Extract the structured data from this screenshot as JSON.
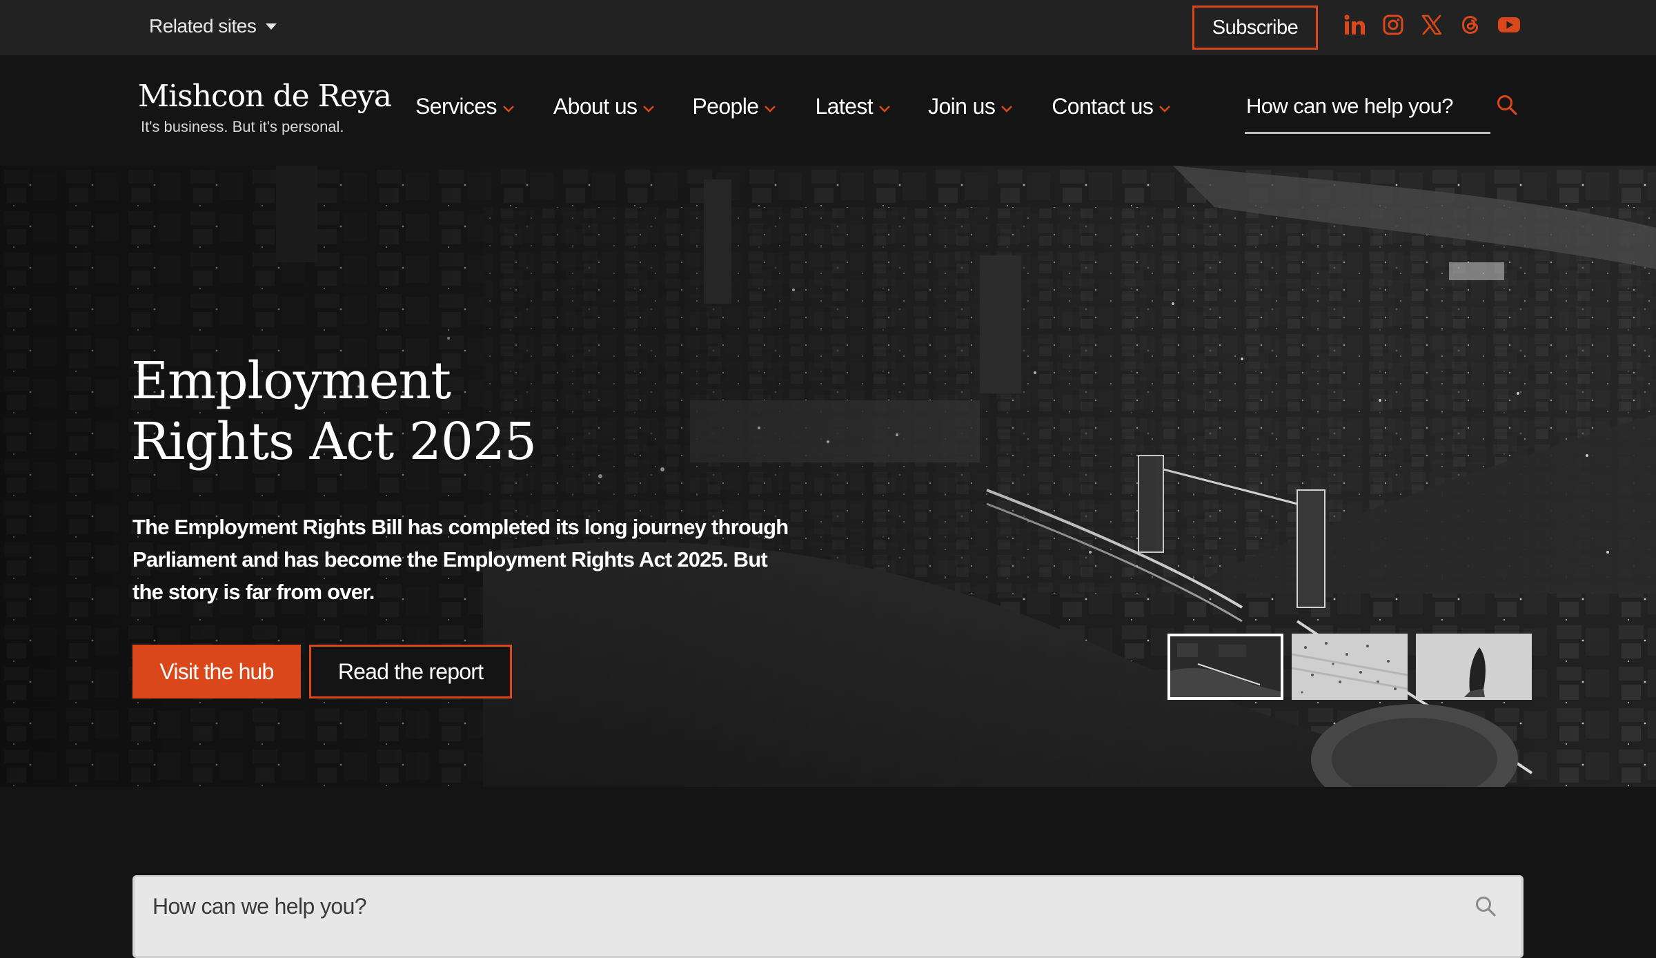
{
  "topbar": {
    "related_label": "Related sites",
    "subscribe_label": "Subscribe",
    "social_icons": [
      "linkedin-icon",
      "instagram-icon",
      "x-icon",
      "threads-icon",
      "youtube-icon"
    ]
  },
  "logo": {
    "name": "Mishcon de Reya",
    "tagline": "It's business. But it's personal."
  },
  "nav": {
    "items": [
      {
        "label": "Services"
      },
      {
        "label": "About us"
      },
      {
        "label": "People"
      },
      {
        "label": "Latest"
      },
      {
        "label": "Join us"
      },
      {
        "label": "Contact us"
      }
    ],
    "search_placeholder": "How can we help you?"
  },
  "hero": {
    "title_line1": "Employment",
    "title_line2": "Rights Act 2025",
    "description": "The Employment Rights Bill has completed its long journey through Parliament and has become the Employment Rights Act 2025. But the story is far from over.",
    "primary_button": "Visit the hub",
    "secondary_button": "Read the report",
    "active_slide": 1,
    "slide_count": 3
  },
  "search": {
    "placeholder": "How can we help you?"
  },
  "colors": {
    "accent": "#d9471b",
    "topbar_bg": "#222222",
    "page_bg": "#141414"
  }
}
